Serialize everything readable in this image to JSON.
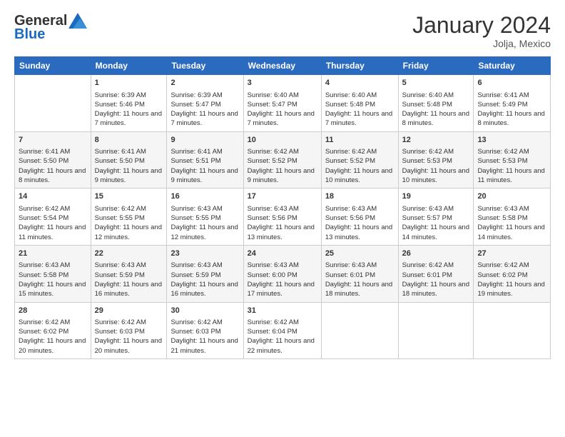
{
  "logo": {
    "general": "General",
    "blue": "Blue"
  },
  "title": "January 2024",
  "location": "Jolja, Mexico",
  "headers": [
    "Sunday",
    "Monday",
    "Tuesday",
    "Wednesday",
    "Thursday",
    "Friday",
    "Saturday"
  ],
  "weeks": [
    [
      {
        "day": "",
        "sunrise": "",
        "sunset": "",
        "daylight": ""
      },
      {
        "day": "1",
        "sunrise": "Sunrise: 6:39 AM",
        "sunset": "Sunset: 5:46 PM",
        "daylight": "Daylight: 11 hours and 7 minutes."
      },
      {
        "day": "2",
        "sunrise": "Sunrise: 6:39 AM",
        "sunset": "Sunset: 5:47 PM",
        "daylight": "Daylight: 11 hours and 7 minutes."
      },
      {
        "day": "3",
        "sunrise": "Sunrise: 6:40 AM",
        "sunset": "Sunset: 5:47 PM",
        "daylight": "Daylight: 11 hours and 7 minutes."
      },
      {
        "day": "4",
        "sunrise": "Sunrise: 6:40 AM",
        "sunset": "Sunset: 5:48 PM",
        "daylight": "Daylight: 11 hours and 7 minutes."
      },
      {
        "day": "5",
        "sunrise": "Sunrise: 6:40 AM",
        "sunset": "Sunset: 5:48 PM",
        "daylight": "Daylight: 11 hours and 8 minutes."
      },
      {
        "day": "6",
        "sunrise": "Sunrise: 6:41 AM",
        "sunset": "Sunset: 5:49 PM",
        "daylight": "Daylight: 11 hours and 8 minutes."
      }
    ],
    [
      {
        "day": "7",
        "sunrise": "Sunrise: 6:41 AM",
        "sunset": "Sunset: 5:50 PM",
        "daylight": "Daylight: 11 hours and 8 minutes."
      },
      {
        "day": "8",
        "sunrise": "Sunrise: 6:41 AM",
        "sunset": "Sunset: 5:50 PM",
        "daylight": "Daylight: 11 hours and 9 minutes."
      },
      {
        "day": "9",
        "sunrise": "Sunrise: 6:41 AM",
        "sunset": "Sunset: 5:51 PM",
        "daylight": "Daylight: 11 hours and 9 minutes."
      },
      {
        "day": "10",
        "sunrise": "Sunrise: 6:42 AM",
        "sunset": "Sunset: 5:52 PM",
        "daylight": "Daylight: 11 hours and 9 minutes."
      },
      {
        "day": "11",
        "sunrise": "Sunrise: 6:42 AM",
        "sunset": "Sunset: 5:52 PM",
        "daylight": "Daylight: 11 hours and 10 minutes."
      },
      {
        "day": "12",
        "sunrise": "Sunrise: 6:42 AM",
        "sunset": "Sunset: 5:53 PM",
        "daylight": "Daylight: 11 hours and 10 minutes."
      },
      {
        "day": "13",
        "sunrise": "Sunrise: 6:42 AM",
        "sunset": "Sunset: 5:53 PM",
        "daylight": "Daylight: 11 hours and 11 minutes."
      }
    ],
    [
      {
        "day": "14",
        "sunrise": "Sunrise: 6:42 AM",
        "sunset": "Sunset: 5:54 PM",
        "daylight": "Daylight: 11 hours and 11 minutes."
      },
      {
        "day": "15",
        "sunrise": "Sunrise: 6:42 AM",
        "sunset": "Sunset: 5:55 PM",
        "daylight": "Daylight: 11 hours and 12 minutes."
      },
      {
        "day": "16",
        "sunrise": "Sunrise: 6:43 AM",
        "sunset": "Sunset: 5:55 PM",
        "daylight": "Daylight: 11 hours and 12 minutes."
      },
      {
        "day": "17",
        "sunrise": "Sunrise: 6:43 AM",
        "sunset": "Sunset: 5:56 PM",
        "daylight": "Daylight: 11 hours and 13 minutes."
      },
      {
        "day": "18",
        "sunrise": "Sunrise: 6:43 AM",
        "sunset": "Sunset: 5:56 PM",
        "daylight": "Daylight: 11 hours and 13 minutes."
      },
      {
        "day": "19",
        "sunrise": "Sunrise: 6:43 AM",
        "sunset": "Sunset: 5:57 PM",
        "daylight": "Daylight: 11 hours and 14 minutes."
      },
      {
        "day": "20",
        "sunrise": "Sunrise: 6:43 AM",
        "sunset": "Sunset: 5:58 PM",
        "daylight": "Daylight: 11 hours and 14 minutes."
      }
    ],
    [
      {
        "day": "21",
        "sunrise": "Sunrise: 6:43 AM",
        "sunset": "Sunset: 5:58 PM",
        "daylight": "Daylight: 11 hours and 15 minutes."
      },
      {
        "day": "22",
        "sunrise": "Sunrise: 6:43 AM",
        "sunset": "Sunset: 5:59 PM",
        "daylight": "Daylight: 11 hours and 16 minutes."
      },
      {
        "day": "23",
        "sunrise": "Sunrise: 6:43 AM",
        "sunset": "Sunset: 5:59 PM",
        "daylight": "Daylight: 11 hours and 16 minutes."
      },
      {
        "day": "24",
        "sunrise": "Sunrise: 6:43 AM",
        "sunset": "Sunset: 6:00 PM",
        "daylight": "Daylight: 11 hours and 17 minutes."
      },
      {
        "day": "25",
        "sunrise": "Sunrise: 6:43 AM",
        "sunset": "Sunset: 6:01 PM",
        "daylight": "Daylight: 11 hours and 18 minutes."
      },
      {
        "day": "26",
        "sunrise": "Sunrise: 6:42 AM",
        "sunset": "Sunset: 6:01 PM",
        "daylight": "Daylight: 11 hours and 18 minutes."
      },
      {
        "day": "27",
        "sunrise": "Sunrise: 6:42 AM",
        "sunset": "Sunset: 6:02 PM",
        "daylight": "Daylight: 11 hours and 19 minutes."
      }
    ],
    [
      {
        "day": "28",
        "sunrise": "Sunrise: 6:42 AM",
        "sunset": "Sunset: 6:02 PM",
        "daylight": "Daylight: 11 hours and 20 minutes."
      },
      {
        "day": "29",
        "sunrise": "Sunrise: 6:42 AM",
        "sunset": "Sunset: 6:03 PM",
        "daylight": "Daylight: 11 hours and 20 minutes."
      },
      {
        "day": "30",
        "sunrise": "Sunrise: 6:42 AM",
        "sunset": "Sunset: 6:03 PM",
        "daylight": "Daylight: 11 hours and 21 minutes."
      },
      {
        "day": "31",
        "sunrise": "Sunrise: 6:42 AM",
        "sunset": "Sunset: 6:04 PM",
        "daylight": "Daylight: 11 hours and 22 minutes."
      },
      {
        "day": "",
        "sunrise": "",
        "sunset": "",
        "daylight": ""
      },
      {
        "day": "",
        "sunrise": "",
        "sunset": "",
        "daylight": ""
      },
      {
        "day": "",
        "sunrise": "",
        "sunset": "",
        "daylight": ""
      }
    ]
  ]
}
